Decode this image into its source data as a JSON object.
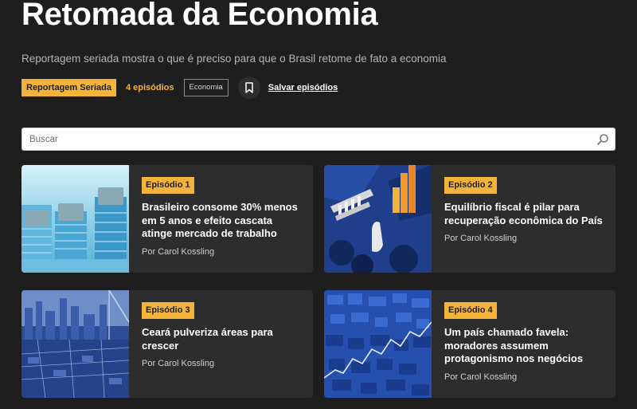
{
  "header": {
    "title": "Retomada da Economia",
    "subtitle": "Reportagem seriada mostra o que é preciso para que o Brasil retome de fato a economia",
    "series_badge": "Reportagem Seriada",
    "episode_count": "4 episódios",
    "tag": "Economia",
    "bookmark_icon": "bookmark-icon",
    "save_label": "Salvar episódios"
  },
  "search": {
    "placeholder": "Buscar",
    "icon": "search-icon"
  },
  "colors": {
    "accent": "#f4b43c",
    "background": "#1e1e1e",
    "card": "#2d2d2d"
  },
  "episodes": [
    {
      "badge": "Episódio 1",
      "title": "Brasileiro consome 30% menos em 5 anos e efeito cascata atinge mercado de trabalho",
      "author": "Por Carol Kossling",
      "image": "coins-image"
    },
    {
      "badge": "Episódio 2",
      "title": "Equilíbrio fiscal é pilar para recuperação econômica do País",
      "author": "Por Carol Kossling",
      "image": "fiscal-balance-image"
    },
    {
      "badge": "Episódio 3",
      "title": "Ceará pulveriza áreas para crescer",
      "author": "Por Carol Kossling",
      "image": "city-skyline-image"
    },
    {
      "badge": "Episódio 4",
      "title": "Um país chamado favela: moradores assumem protagonismo nos negócios",
      "author": "Por Carol Kossling",
      "image": "favela-image"
    }
  ]
}
